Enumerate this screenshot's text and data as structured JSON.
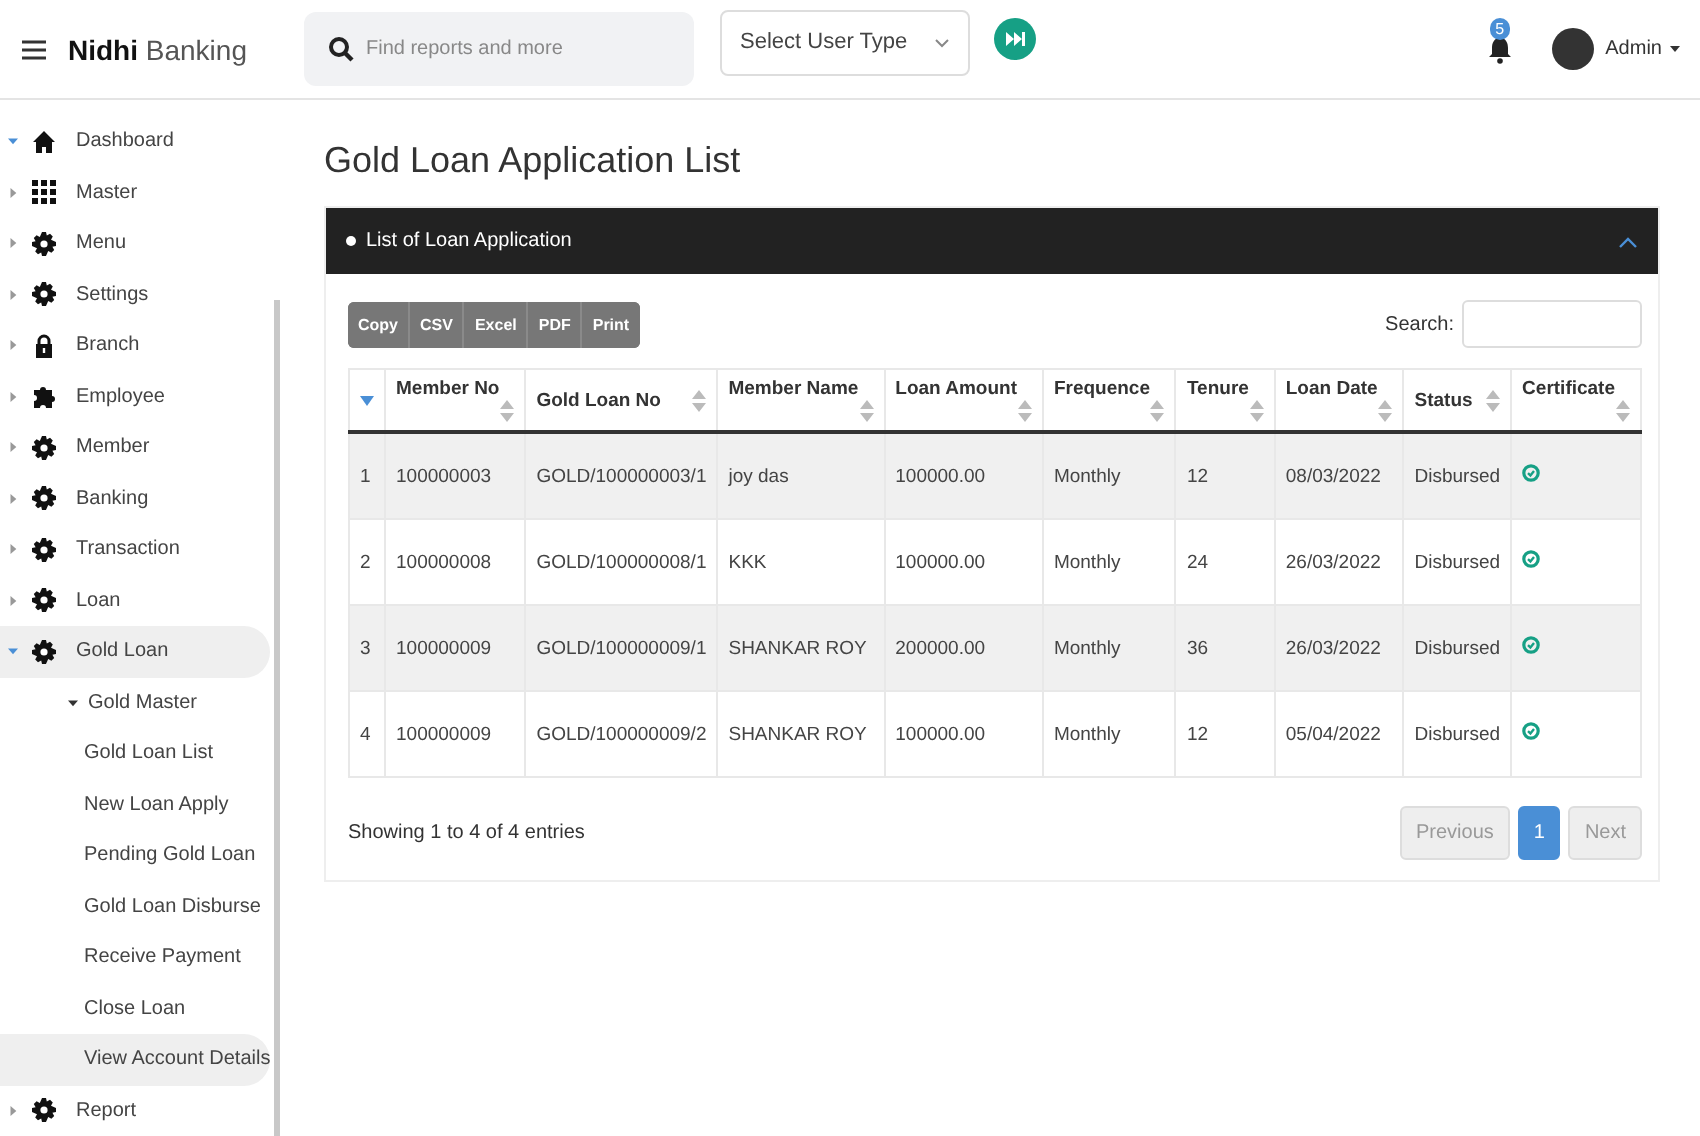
{
  "header": {
    "brand_bold": "Nidhi",
    "brand_rest": "Banking",
    "search": {
      "placeholder": "Find reports and more"
    },
    "user_type_select": {
      "value": "Select User Type"
    },
    "notification_count": "5",
    "user": "Admin"
  },
  "sidebar": {
    "items": [
      {
        "label": "Dashboard",
        "kind": "home",
        "expanded": true,
        "selected": false
      },
      {
        "label": "Master",
        "kind": "grid",
        "expanded": false,
        "selected": false
      },
      {
        "label": "Menu",
        "kind": "gear",
        "expanded": false,
        "selected": false
      },
      {
        "label": "Settings",
        "kind": "gear",
        "expanded": false,
        "selected": false
      },
      {
        "label": "Branch",
        "kind": "lock",
        "expanded": false,
        "selected": false
      },
      {
        "label": "Employee",
        "kind": "puzzle",
        "expanded": false,
        "selected": false
      },
      {
        "label": "Member",
        "kind": "gear",
        "expanded": false,
        "selected": false
      },
      {
        "label": "Banking",
        "kind": "gear",
        "expanded": false,
        "selected": false
      },
      {
        "label": "Transaction",
        "kind": "gear",
        "expanded": false,
        "selected": false
      },
      {
        "label": "Loan",
        "kind": "gear",
        "expanded": false,
        "selected": false
      },
      {
        "label": "Gold Loan",
        "kind": "gear",
        "expanded": true,
        "selected": true,
        "children": [
          {
            "label": "Gold Master",
            "expanded": true,
            "selected": false,
            "children": [
              {
                "label": "Gold Loan List",
                "selected": false
              },
              {
                "label": "New Loan Apply",
                "selected": false
              },
              {
                "label": "Pending Gold Loan",
                "selected": false
              },
              {
                "label": "Gold Loan Disburse",
                "selected": false
              },
              {
                "label": "Receive Payment",
                "selected": false
              },
              {
                "label": "Close Loan",
                "selected": false
              },
              {
                "label": "View Account Details",
                "selected": true
              }
            ]
          }
        ]
      },
      {
        "label": "Report",
        "kind": "gear",
        "expanded": false,
        "selected": false
      }
    ]
  },
  "page_title": "Gold Loan Application List",
  "card": {
    "title": "List of Loan Application",
    "expanded": true,
    "export_buttons": [
      "Copy",
      "CSV",
      "Excel",
      "PDF",
      "Print"
    ],
    "search_label": "Search:",
    "table": {
      "columns": [
        {
          "sorted": true
        },
        {
          "label": "Member No",
          "sorted": false
        },
        {
          "label": "Gold Loan No",
          "sorted": false
        },
        {
          "label": "Member Name",
          "sorted": false
        },
        {
          "label": "Loan Amount",
          "sorted": false
        },
        {
          "label": "Frequence",
          "sorted": false
        },
        {
          "label": "Tenure",
          "sorted": false
        },
        {
          "label": "Loan Date",
          "sorted": false
        },
        {
          "label": "Status",
          "sorted": false
        },
        {
          "label": "Certificate",
          "sorted": false
        }
      ],
      "rows": [
        [
          "1",
          "100000003",
          "GOLD/100000003/1",
          "joy das",
          "100000.00",
          "Monthly",
          "12",
          "08/03/2022",
          "Disbursed"
        ],
        [
          "2",
          "100000008",
          "GOLD/100000008/1",
          "KKK",
          "100000.00",
          "Monthly",
          "24",
          "26/03/2022",
          "Disbursed"
        ],
        [
          "3",
          "100000009",
          "GOLD/100000009/1",
          "SHANKAR ROY",
          "200000.00",
          "Monthly",
          "36",
          "26/03/2022",
          "Disbursed"
        ],
        [
          "4",
          "100000009",
          "GOLD/100000009/2",
          "SHANKAR ROY",
          "100000.00",
          "Monthly",
          "12",
          "05/04/2022",
          "Disbursed"
        ]
      ]
    },
    "info": "Showing 1 to 4 of 4 entries",
    "pagination": [
      {
        "label": "Previous",
        "disabled": true,
        "selected": false
      },
      {
        "label": "1",
        "disabled": false,
        "selected": true
      },
      {
        "label": "Next",
        "disabled": true,
        "selected": false
      }
    ]
  }
}
